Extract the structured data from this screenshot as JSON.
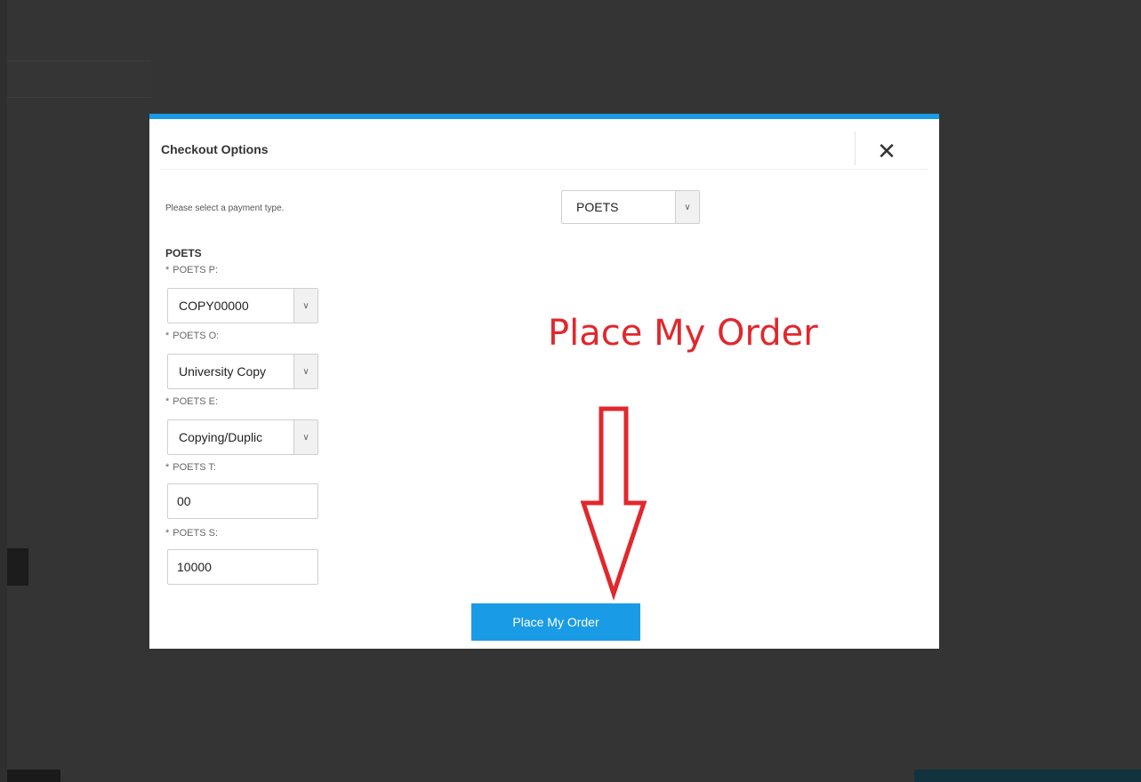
{
  "modal": {
    "title": "Checkout Options",
    "close_glyph": "✕",
    "payment_prompt": "Please select a payment type.",
    "payment_type_value": "POETS",
    "section_label": "POETS",
    "required_mark": "*",
    "fields": [
      {
        "label": "POETS P:",
        "type": "select",
        "value": "COPY00000"
      },
      {
        "label": "POETS O:",
        "type": "select",
        "value": "University Copy"
      },
      {
        "label": "POETS E:",
        "type": "select",
        "value": "Copying/Duplic"
      },
      {
        "label": "POETS T:",
        "type": "input",
        "value": "00"
      },
      {
        "label": "POETS S:",
        "type": "input",
        "value": "10000"
      }
    ],
    "submit_label": "Place My Order"
  },
  "annotation": {
    "text": "Place My Order",
    "color": "#e0282d"
  },
  "colors": {
    "accent": "#1a9be6",
    "overlay": "#2f2f2f"
  },
  "icons": {
    "close": "close-icon",
    "dropdown": "chevron-down-icon",
    "annotation_arrow": "down-arrow-icon"
  }
}
